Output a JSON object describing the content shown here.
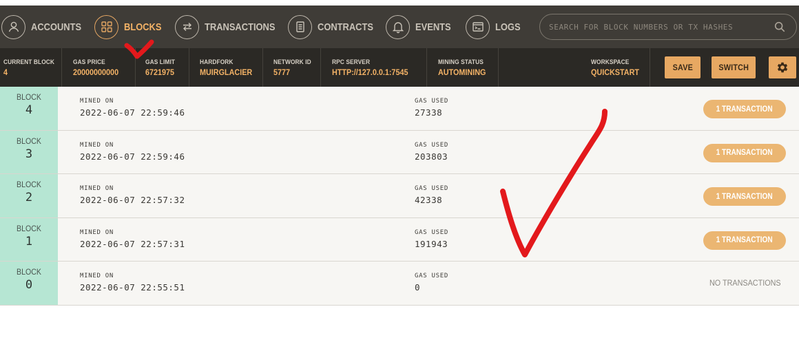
{
  "nav": {
    "items": [
      {
        "label": "ACCOUNTS",
        "icon": "person-icon",
        "active": false
      },
      {
        "label": "BLOCKS",
        "icon": "blocks-grid-icon",
        "active": true
      },
      {
        "label": "TRANSACTIONS",
        "icon": "swap-arrows-icon",
        "active": false
      },
      {
        "label": "CONTRACTS",
        "icon": "document-icon",
        "active": false
      },
      {
        "label": "EVENTS",
        "icon": "bell-icon",
        "active": false
      },
      {
        "label": "LOGS",
        "icon": "terminal-icon",
        "active": false
      }
    ],
    "search_placeholder": "SEARCH FOR BLOCK NUMBERS OR TX HASHES"
  },
  "status": {
    "current_block": {
      "label": "CURRENT BLOCK",
      "value": "4"
    },
    "gas_price": {
      "label": "GAS PRICE",
      "value": "20000000000"
    },
    "gas_limit": {
      "label": "GAS LIMIT",
      "value": "6721975"
    },
    "hardfork": {
      "label": "HARDFORK",
      "value": "MUIRGLACIER"
    },
    "network_id": {
      "label": "NETWORK ID",
      "value": "5777"
    },
    "rpc_server": {
      "label": "RPC SERVER",
      "value": "HTTP://127.0.0.1:7545"
    },
    "mining_status": {
      "label": "MINING STATUS",
      "value": "AUTOMINING"
    },
    "workspace": {
      "label": "WORKSPACE",
      "value": "QUICKSTART"
    },
    "save_label": "SAVE",
    "switch_label": "SWITCH"
  },
  "blocks": [
    {
      "block_label": "BLOCK",
      "number": "4",
      "mined_label": "MINED ON",
      "mined_on": "2022-06-07 22:59:46",
      "gas_label": "GAS USED",
      "gas_used": "27338",
      "tx_label": "1 TRANSACTION"
    },
    {
      "block_label": "BLOCK",
      "number": "3",
      "mined_label": "MINED ON",
      "mined_on": "2022-06-07 22:59:46",
      "gas_label": "GAS USED",
      "gas_used": "203803",
      "tx_label": "1 TRANSACTION"
    },
    {
      "block_label": "BLOCK",
      "number": "2",
      "mined_label": "MINED ON",
      "mined_on": "2022-06-07 22:57:32",
      "gas_label": "GAS USED",
      "gas_used": "42338",
      "tx_label": "1 TRANSACTION"
    },
    {
      "block_label": "BLOCK",
      "number": "1",
      "mined_label": "MINED ON",
      "mined_on": "2022-06-07 22:57:31",
      "gas_label": "GAS USED",
      "gas_used": "191943",
      "tx_label": "1 TRANSACTION"
    },
    {
      "block_label": "BLOCK",
      "number": "0",
      "mined_label": "MINED ON",
      "mined_on": "2022-06-07 22:55:51",
      "gas_label": "GAS USED",
      "gas_used": "0",
      "tx_label": "NO TRANSACTIONS"
    }
  ],
  "colors": {
    "accent": "#f3b266",
    "nav_bg": "#3f3c37",
    "status_bg": "#2b2925",
    "block_badge": "#b6e6d3",
    "annotation_mark": "#e3191c"
  },
  "annotations": [
    "red-checkmark-near-blocks-tab",
    "large-red-checkmark-over-list"
  ]
}
